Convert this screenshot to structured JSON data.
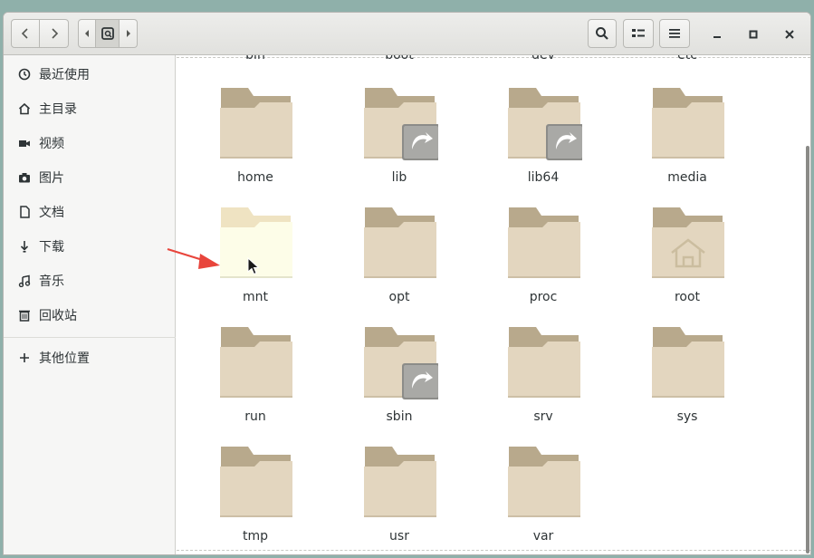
{
  "sidebar": {
    "items": [
      {
        "label": "最近使用",
        "icon": "clock-icon"
      },
      {
        "label": "主目录",
        "icon": "home-icon"
      },
      {
        "label": "视频",
        "icon": "video-icon"
      },
      {
        "label": "图片",
        "icon": "camera-icon"
      },
      {
        "label": "文档",
        "icon": "document-icon"
      },
      {
        "label": "下载",
        "icon": "download-icon"
      },
      {
        "label": "音乐",
        "icon": "music-icon"
      },
      {
        "label": "回收站",
        "icon": "trash-icon"
      }
    ],
    "other_locations": {
      "label": "其他位置",
      "icon": "plus-icon"
    }
  },
  "files": {
    "partial_row": [
      "bin",
      "boot",
      "dev",
      "etc"
    ],
    "items": [
      {
        "name": "home",
        "symlink": false,
        "emblem": ""
      },
      {
        "name": "lib",
        "symlink": true,
        "emblem": ""
      },
      {
        "name": "lib64",
        "symlink": true,
        "emblem": ""
      },
      {
        "name": "media",
        "symlink": false,
        "emblem": ""
      },
      {
        "name": "mnt",
        "symlink": false,
        "emblem": "",
        "hovered": true
      },
      {
        "name": "opt",
        "symlink": false,
        "emblem": ""
      },
      {
        "name": "proc",
        "symlink": false,
        "emblem": ""
      },
      {
        "name": "root",
        "symlink": false,
        "emblem": "home"
      },
      {
        "name": "run",
        "symlink": false,
        "emblem": ""
      },
      {
        "name": "sbin",
        "symlink": true,
        "emblem": ""
      },
      {
        "name": "srv",
        "symlink": false,
        "emblem": ""
      },
      {
        "name": "sys",
        "symlink": false,
        "emblem": ""
      },
      {
        "name": "tmp",
        "symlink": false,
        "emblem": ""
      },
      {
        "name": "usr",
        "symlink": false,
        "emblem": ""
      },
      {
        "name": "var",
        "symlink": false,
        "emblem": ""
      }
    ]
  },
  "colors": {
    "folder_back": "#b8a98c",
    "folder_front": "#e3d6bf",
    "folder_hover_back": "#efe3c2",
    "folder_hover_front": "#fdfde8",
    "arrow": "#e8453c"
  }
}
